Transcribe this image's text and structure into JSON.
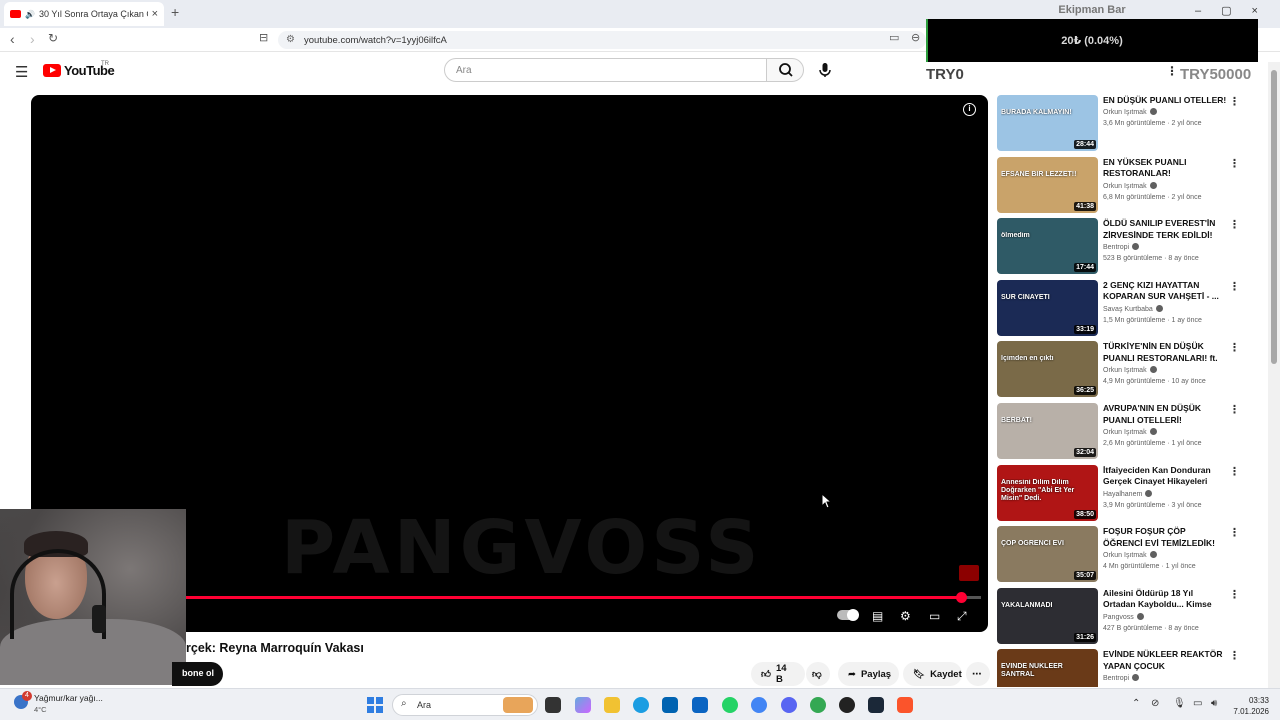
{
  "browser": {
    "tab_title": "30 Yıl Sonra Ortaya Çıkan Ger",
    "url": "youtube.com/watch?v=1yyj06ilfcA"
  },
  "overlay": {
    "title": "Ekipman Bar",
    "value": "20₺ (0.04%)",
    "progress_fraction": 0.0004,
    "start_label": "TRY0",
    "goal_label": "TRY50000"
  },
  "youtube": {
    "logo_text": "YouTube",
    "region": "TR",
    "search_placeholder": "Ara"
  },
  "player": {
    "watermark": "PANGVOSS",
    "progress_fraction": 0.975
  },
  "video": {
    "title": "rçek: Reyna Marroquín Vakası",
    "subscribe_label": "bone ol",
    "likes": "14 B",
    "share_label": "Paylaş",
    "save_label": "Kaydet"
  },
  "recommendations": [
    {
      "title": "EN DÜŞÜK PUANLI OTELLER!",
      "channel": "Orkun Işıtmak",
      "verified": true,
      "views": "3,6 Mn görüntüleme",
      "age": "2 yıl önce",
      "duration": "28:44",
      "thumb_color": "#9cc4e4",
      "overlay_text": "BURADA KALMAYIN!"
    },
    {
      "title": "EN YÜKSEK PUANLI RESTORANLAR!",
      "channel": "Orkun Işıtmak",
      "verified": true,
      "views": "6,8 Mn görüntüleme",
      "age": "2 yıl önce",
      "duration": "41:38",
      "thumb_color": "#c9a36a",
      "overlay_text": "EFSANE BİR LEZZET!!"
    },
    {
      "title": "ÖLDÜ SANILIP EVEREST'İN ZİRVESİNDE TERK EDİLDİ!",
      "channel": "Bentropi",
      "verified": true,
      "views": "523 B görüntüleme",
      "age": "8 ay önce",
      "duration": "17:44",
      "thumb_color": "#2f5a66",
      "overlay_text": "ölmedim"
    },
    {
      "title": "2 GENÇ KIZI HAYATTAN KOPARAN SUR VAHŞETİ - ...",
      "channel": "Savaş Kurtbaba",
      "verified": true,
      "views": "1,5 Mn görüntüleme",
      "age": "1 ay önce",
      "duration": "33:19",
      "thumb_color": "#1b2a55",
      "overlay_text": "SUR CİNAYETİ"
    },
    {
      "title": "TÜRKİYE'NİN EN DÜŞÜK PUANLI RESTORANLARI! ft. ...",
      "channel": "Orkun Işıtmak",
      "verified": true,
      "views": "4,9 Mn görüntüleme",
      "age": "10 ay önce",
      "duration": "36:25",
      "thumb_color": "#7a6a48",
      "overlay_text": "İçimden en çıktı"
    },
    {
      "title": "AVRUPA'NIN EN DÜŞÜK PUANLI OTELLERİ!",
      "channel": "Orkun Işıtmak",
      "verified": true,
      "views": "2,6 Mn görüntüleme",
      "age": "1 yıl önce",
      "duration": "32:04",
      "thumb_color": "#b8b0a8",
      "overlay_text": "BERBAT!"
    },
    {
      "title": "İtfaiyeciden Kan Donduran Gerçek Cinayet Hikayeleri",
      "channel": "Hayalhanem",
      "verified": true,
      "views": "3,9 Mn görüntüleme",
      "age": "3 yıl önce",
      "duration": "38:50",
      "thumb_color": "#b01515",
      "overlay_text": "Annesini Dilim Dilim Doğrarken \"Abi Et Yer Misin\" Dedi."
    },
    {
      "title": "FOŞUR FOŞUR ÇÖP ÖĞRENCİ EVİ TEMİZLEDİK! @Cem Özkök",
      "channel": "Orkun Işıtmak",
      "verified": true,
      "views": "4 Mn görüntüleme",
      "age": "1 yıl önce",
      "duration": "35:07",
      "thumb_color": "#8a7a60",
      "overlay_text": "ÇÖP ÖĞRENCİ EVİ"
    },
    {
      "title": "Ailesini Öldürüp 18 Yıl Ortadan Kayboldu... Kimse Onu ...",
      "channel": "Pangvoss",
      "verified": true,
      "views": "427 B görüntüleme",
      "age": "8 ay önce",
      "duration": "31:26",
      "thumb_color": "#2d2d33",
      "overlay_text": "YAKALANMADI"
    },
    {
      "title": "EVİNDE NÜKLEER REAKTÖR YAPAN ÇOCUK",
      "channel": "Bentropi",
      "verified": true,
      "views": "",
      "age": "",
      "duration": "",
      "thumb_color": "#6a3a18",
      "overlay_text": "EVİNDE NÜKLEER SANTRAL"
    }
  ],
  "taskbar": {
    "weather_text": "Yağmur/kar yağı...",
    "temperature": "4°C",
    "weather_badge": "4",
    "search_label": "Ara",
    "time": "03:33",
    "date": "7.01.2026"
  }
}
